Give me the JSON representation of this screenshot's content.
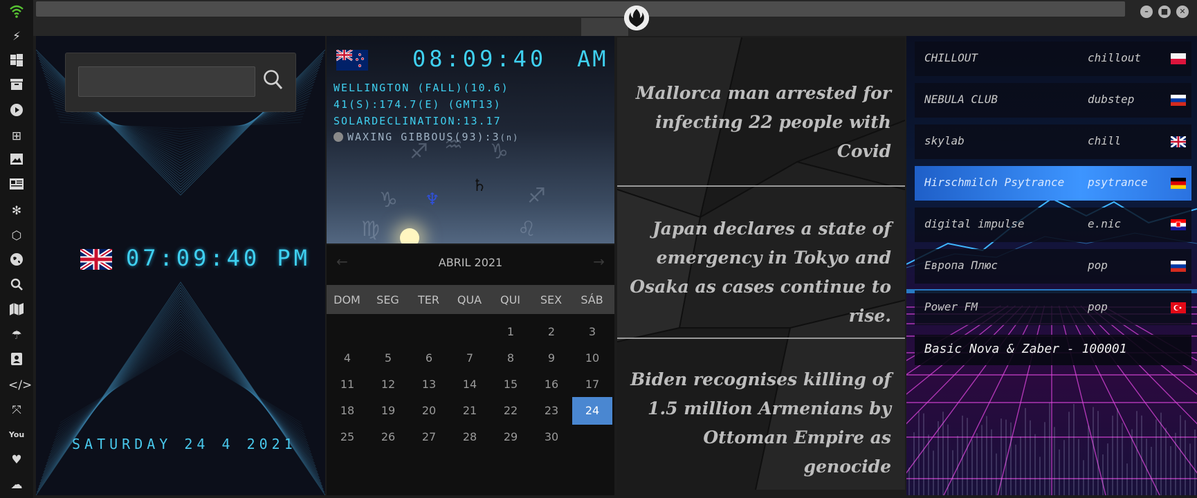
{
  "sidebar": {
    "icons": [
      "wifi-icon",
      "lightning-icon",
      "windows-icon",
      "archive-icon",
      "play-icon",
      "maps-icon",
      "image-icon",
      "news-icon",
      "settings-icon",
      "hexagon-icon",
      "globe-icon",
      "search-icon",
      "map-icon",
      "umbrella-icon",
      "contacts-icon",
      "code-icon",
      "expand-icon",
      "youtube-icon",
      "heart-icon",
      "cloud-icon"
    ]
  },
  "topbar": {
    "window_buttons": [
      "–",
      "■",
      "✕"
    ]
  },
  "search": {
    "placeholder": ""
  },
  "clock": {
    "flag": "uk",
    "time": "07:09:40 PM",
    "date": "SATURDAY 24 4 2021"
  },
  "weather": {
    "flag": "nz",
    "time": "08:09:40",
    "ampm": "AM",
    "line1": "WELLINGTON (FALL)(10.6)",
    "line2": "41(S):174.7(E) (GMT13)",
    "line3": "SOLARDECLINATION:13.17",
    "moon": "WAXING GIBBOUS(93):3",
    "moon_suffix": "(n)",
    "planet_saturn": "♄",
    "planet_neptune": "♆"
  },
  "calendar": {
    "title": "ABRIL 2021",
    "prev": "←",
    "next": "→",
    "weekdays": [
      "DOM",
      "SEG",
      "TER",
      "QUA",
      "QUI",
      "SEX",
      "SÁB"
    ],
    "first_weekday": 4,
    "days_in_month": 30,
    "today": 24
  },
  "news": [
    "Mallorca man arrested for infecting 22 people with Covid",
    "Japan declares a state of emergency in Tokyo and Osaka as cases continue to rise.",
    "Biden recognises killing of 1.5 million Armenians by Ottoman Empire as genocide"
  ],
  "radio": {
    "stations": [
      {
        "name": "CHILLOUT",
        "genre": "chillout",
        "flag": "poland",
        "active": false
      },
      {
        "name": "NEBULA CLUB",
        "genre": "dubstep",
        "flag": "russia",
        "active": false
      },
      {
        "name": "skylab",
        "genre": "chill",
        "flag": "uk",
        "active": false
      },
      {
        "name": "Hirschmilch Psytrance",
        "genre": "psytrance",
        "flag": "germany",
        "active": true
      },
      {
        "name": "digital impulse",
        "genre": "e.nic",
        "flag": "croatia",
        "active": false
      },
      {
        "name": "Европа Плюс",
        "genre": "pop",
        "flag": "russia",
        "active": false
      },
      {
        "name": "Power FM",
        "genre": "pop",
        "flag": "turkey",
        "active": false
      }
    ],
    "now_playing": "Basic Nova & Zaber - 100001"
  }
}
